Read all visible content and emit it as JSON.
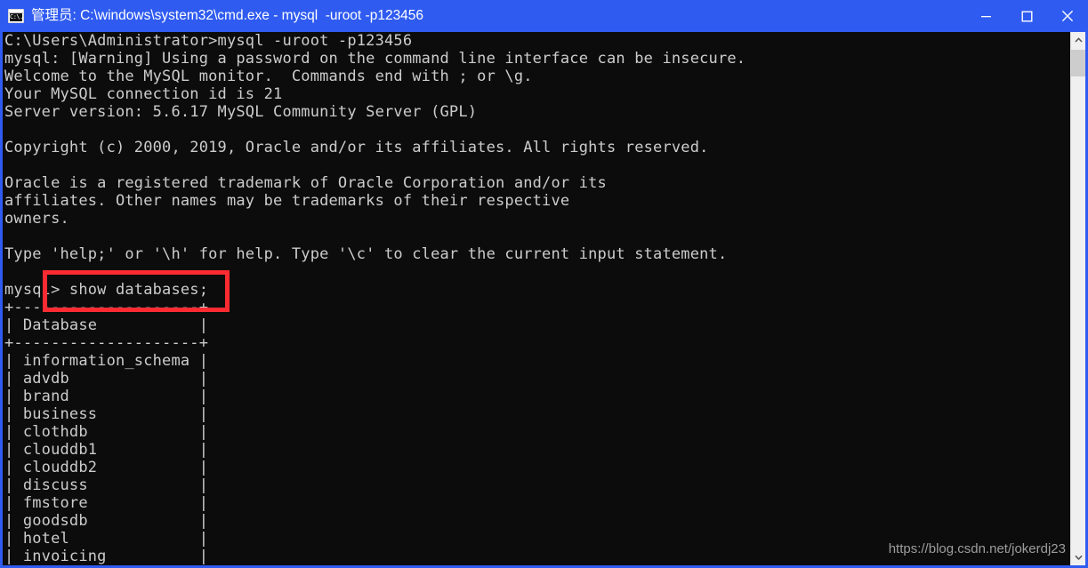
{
  "window": {
    "title": "管理员: C:\\windows\\system32\\cmd.exe - mysql  -uroot -p123456",
    "icon_label": "C:\\.",
    "icon_name": "cmd-console-icon",
    "controls": {
      "minimize": "minimize-icon",
      "maximize": "maximize-icon",
      "close": "close-icon"
    }
  },
  "console": {
    "prompt_path": "C:\\Users\\Administrator>",
    "command_entered": "mysql -uroot -p123456",
    "mysql_prompt": "mysql>",
    "highlighted_command": "show databases;",
    "lines": [
      "C:\\Users\\Administrator>mysql -uroot -p123456",
      "mysql: [Warning] Using a password on the command line interface can be insecure.",
      "Welcome to the MySQL monitor.  Commands end with ; or \\g.",
      "Your MySQL connection id is 21",
      "Server version: 5.6.17 MySQL Community Server (GPL)",
      "",
      "Copyright (c) 2000, 2019, Oracle and/or its affiliates. All rights reserved.",
      "",
      "Oracle is a registered trademark of Oracle Corporation and/or its",
      "affiliates. Other names may be trademarks of their respective",
      "owners.",
      "",
      "Type 'help;' or '\\h' for help. Type '\\c' to clear the current input statement.",
      "",
      "mysql> show databases;",
      "+--------------------+",
      "| Database           |",
      "+--------------------+",
      "| information_schema |",
      "| advdb              |",
      "| brand              |",
      "| business           |",
      "| clothdb            |",
      "| clouddb1           |",
      "| clouddb2           |",
      "| discuss            |",
      "| fmstore            |",
      "| goodsdb            |",
      "| hotel              |",
      "| invoicing          |"
    ],
    "table": {
      "border": "+--------------------+",
      "header": "Database",
      "rows": [
        "information_schema",
        "advdb",
        "brand",
        "business",
        "clothdb",
        "clouddb1",
        "clouddb2",
        "discuss",
        "fmstore",
        "goodsdb",
        "hotel",
        "invoicing"
      ]
    },
    "server_info": {
      "connection_id": "21",
      "server_version": "5.6.17 MySQL Community Server (GPL)",
      "copyright_years": "2000, 2019"
    }
  },
  "watermark": {
    "text": "https://blog.csdn.net/jokerdj23"
  },
  "scrollbar": {
    "up_arrow": "chevron-up-icon",
    "down_arrow": "chevron-down-icon"
  },
  "colors": {
    "titlebar_blue": "#2f5bf0",
    "console_bg": "#0c0c0c",
    "console_fg": "#cccccc",
    "highlight_red": "#fc2b32",
    "scrollbar_track": "#f0f0f0",
    "scrollbar_thumb": "#cdcdcd"
  }
}
